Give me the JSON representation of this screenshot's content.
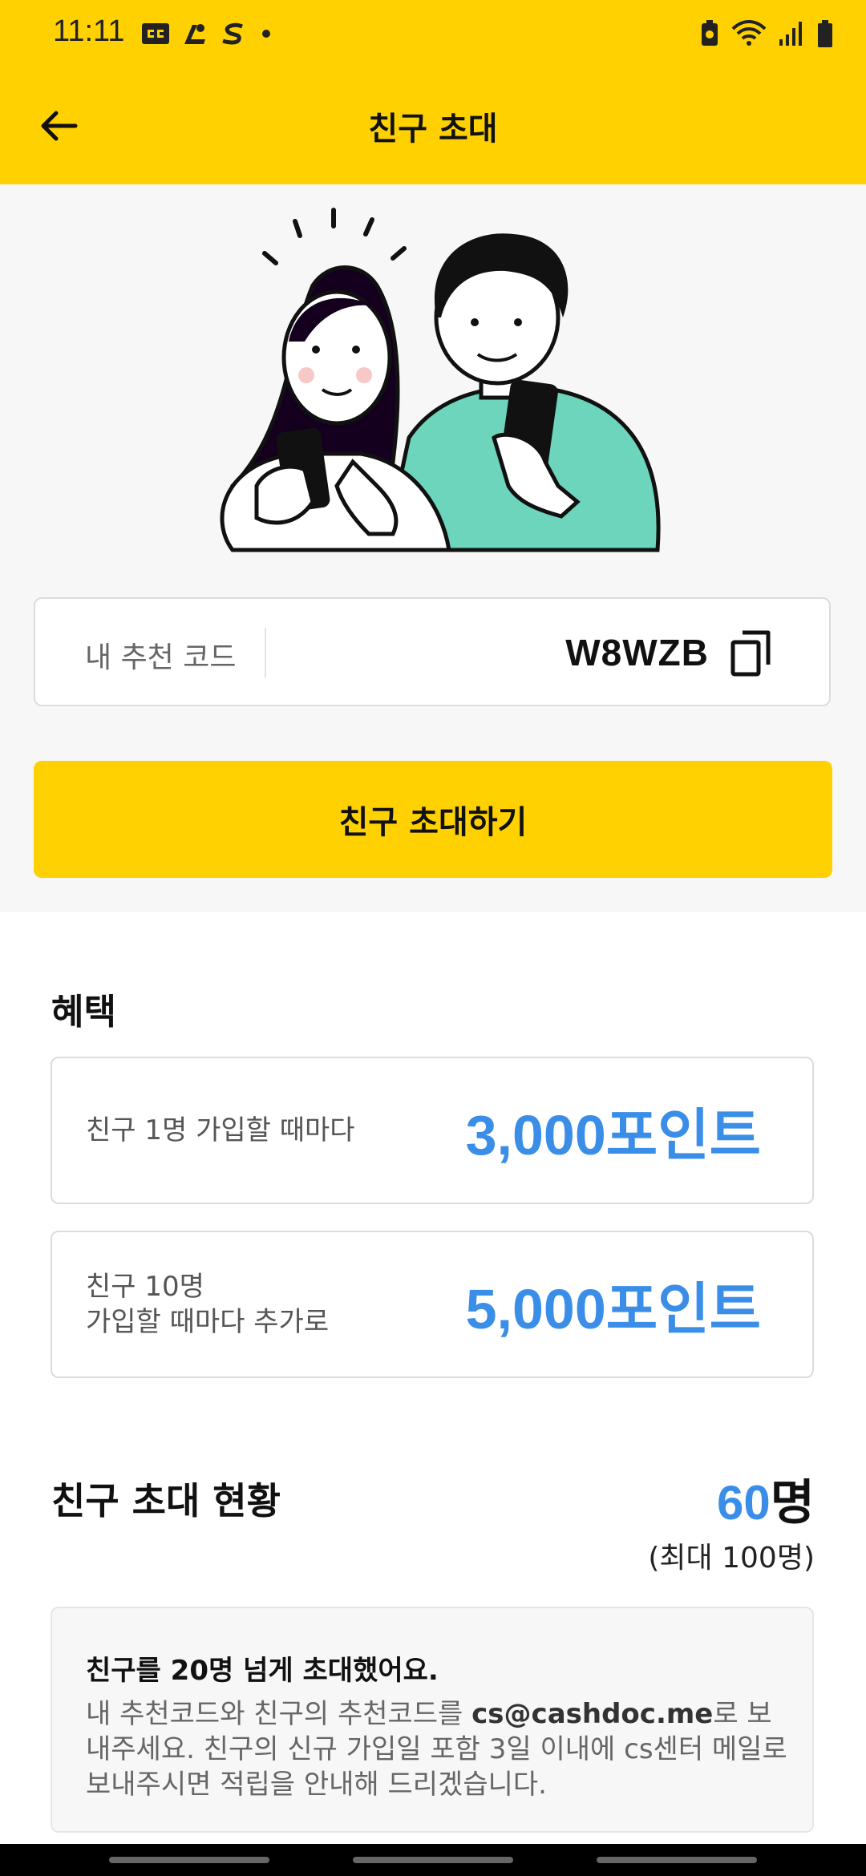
{
  "status_bar": {
    "time": "11:11",
    "left_icons": [
      "caption-icon",
      "notification-app-icon",
      "s-app-icon",
      "dot-icon"
    ],
    "right_icons": [
      "battery-saver-icon",
      "wifi-icon",
      "signal-icon",
      "battery-icon"
    ]
  },
  "header": {
    "title": "친구 초대"
  },
  "referral": {
    "label": "내 추천 코드",
    "code": "W8WZB"
  },
  "invite_button": "친구 초대하기",
  "benefits": {
    "title": "혜택",
    "items": [
      {
        "label_lines": [
          "친구 1명 가입할 때마다"
        ],
        "value": "3,000포인트"
      },
      {
        "label_lines": [
          "친구 10명",
          "가입할 때마다 추가로"
        ],
        "value": "5,000포인트"
      }
    ]
  },
  "invite_status": {
    "title": "친구 초대 현황",
    "count": "60",
    "unit": "명",
    "max": "(최대 100명)"
  },
  "notice": {
    "title": "친구를 20명 넘게 초대했어요.",
    "body_pre": "내 추천코드와 친구의 추천코드를 ",
    "email": "cs@cashdoc.me",
    "body_post": "로 보내주세요. 친구의 신규 가입일 포함 3일 이내에 cs센터 메일로 보내주시면 적립을 안내해 드리겠습니다."
  },
  "colors": {
    "brand_yellow": "#FFD100",
    "accent_blue": "#3A8EE8",
    "hero_green": "#6DD5BC"
  }
}
